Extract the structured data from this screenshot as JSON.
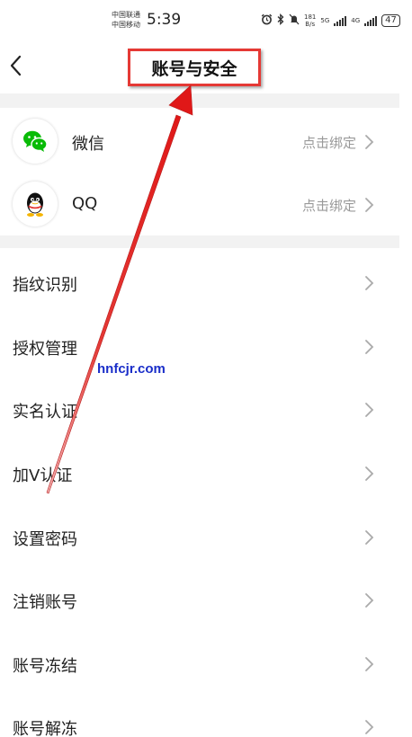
{
  "status_bar": {
    "carrier_1": "中国联通",
    "carrier_2": "中国移动",
    "time": "5:39",
    "speed_value": "181",
    "speed_unit": "B/s",
    "network_1": "5G",
    "network_2": "4G",
    "battery": "47"
  },
  "header": {
    "title": "账号与安全"
  },
  "bindings": [
    {
      "label": "微信",
      "action": "点击绑定",
      "icon": "wechat-icon",
      "color": "#09bb07"
    },
    {
      "label": "QQ",
      "action": "点击绑定",
      "icon": "qq-icon",
      "color": "#000000"
    }
  ],
  "menu": [
    {
      "label": "指纹识别"
    },
    {
      "label": "授权管理"
    },
    {
      "label": "实名认证"
    },
    {
      "label": "加V认证"
    },
    {
      "label": "设置密码"
    },
    {
      "label": "注销账号"
    },
    {
      "label": "账号冻结"
    },
    {
      "label": "账号解冻"
    }
  ],
  "watermark": "hnfcjr.com",
  "colors": {
    "annotation_red": "#e53935",
    "secondary_text": "#999999",
    "section_gap": "#f2f2f2"
  }
}
